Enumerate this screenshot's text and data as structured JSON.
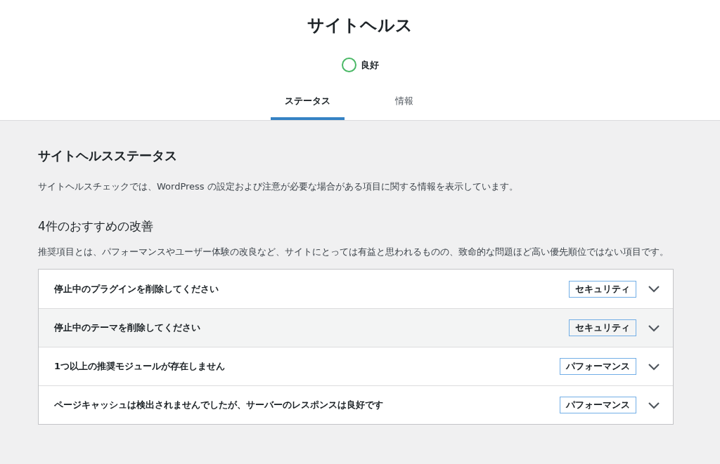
{
  "header": {
    "title": "サイトヘルス",
    "status": {
      "label": "良好",
      "kind": "good"
    },
    "tabs": [
      {
        "label": "ステータス",
        "selected": true
      },
      {
        "label": "情報",
        "selected": false
      }
    ]
  },
  "section": {
    "title": "サイトヘルスステータス",
    "description": "サイトヘルスチェックでは、WordPress の設定および注意が必要な場合がある項目に関する情報を表示しています。"
  },
  "recommended": {
    "title": "4件のおすすめの改善",
    "description": "推奨項目とは、パフォーマンスやユーザー体験の改良など、サイトにとっては有益と思われるものの、致命的な問題ほど高い優先順位ではない項目です。",
    "items": [
      {
        "label": "停止中のプラグインを削除してください",
        "badge": "セキュリティ",
        "expanded": false,
        "highlighted": false
      },
      {
        "label": "停止中のテーマを削除してください",
        "badge": "セキュリティ",
        "expanded": false,
        "highlighted": true
      },
      {
        "label": "1つ以上の推奨モジュールが存在しません",
        "badge": "パフォーマンス",
        "expanded": false,
        "highlighted": false
      },
      {
        "label": "ページキャッシュは検出されませんでしたが、サーバーのレスポンスは良好です",
        "badge": "パフォーマンス",
        "expanded": false,
        "highlighted": false
      }
    ]
  }
}
